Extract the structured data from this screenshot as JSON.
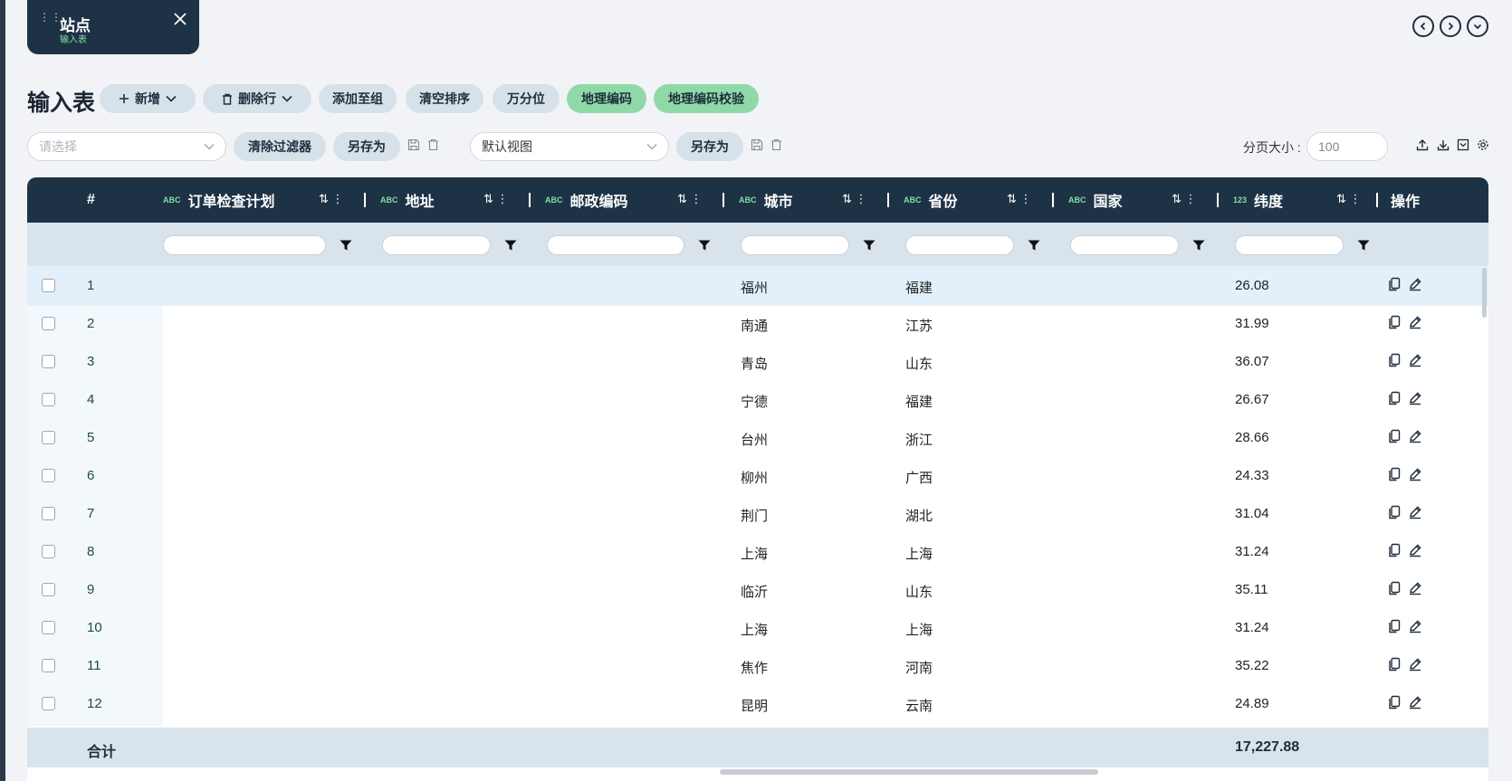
{
  "tab": {
    "title": "站点",
    "subtitle": "输入表"
  },
  "page": {
    "title": "输入表"
  },
  "toolbar": {
    "add_label": "新增",
    "delete_label": "删除行",
    "add_group_label": "添加至组",
    "clear_sort_label": "清空排序",
    "permille_label": "万分位",
    "geocode_label": "地理编码",
    "geocode_check_label": "地理编码校验"
  },
  "filterbar": {
    "select_placeholder": "请选择",
    "clear_filter_label": "清除过滤器",
    "save_as_label": "另存为",
    "view_value": "默认视图",
    "save_as_label_2": "另存为",
    "page_size_label": "分页大小 :",
    "page_size_value": "100"
  },
  "columns": {
    "index": "#",
    "c1": {
      "type": "ABC",
      "label": "订单检查计划"
    },
    "c2": {
      "type": "ABC",
      "label": "地址"
    },
    "c3": {
      "type": "ABC",
      "label": "邮政编码"
    },
    "c4": {
      "type": "ABC",
      "label": "城市"
    },
    "c5": {
      "type": "ABC",
      "label": "省份"
    },
    "c6": {
      "type": "ABC",
      "label": "国家"
    },
    "c7": {
      "type": "123",
      "label": "纬度"
    },
    "actions": "操作"
  },
  "rows": [
    {
      "n": "1",
      "city": "福州",
      "province": "福建",
      "lat": "26.08"
    },
    {
      "n": "2",
      "city": "南通",
      "province": "江苏",
      "lat": "31.99"
    },
    {
      "n": "3",
      "city": "青岛",
      "province": "山东",
      "lat": "36.07"
    },
    {
      "n": "4",
      "city": "宁德",
      "province": "福建",
      "lat": "26.67"
    },
    {
      "n": "5",
      "city": "台州",
      "province": "浙江",
      "lat": "28.66"
    },
    {
      "n": "6",
      "city": "柳州",
      "province": "广西",
      "lat": "24.33"
    },
    {
      "n": "7",
      "city": "荆门",
      "province": "湖北",
      "lat": "31.04"
    },
    {
      "n": "8",
      "city": "上海",
      "province": "上海",
      "lat": "31.24"
    },
    {
      "n": "9",
      "city": "临沂",
      "province": "山东",
      "lat": "35.11"
    },
    {
      "n": "10",
      "city": "上海",
      "province": "上海",
      "lat": "31.24"
    },
    {
      "n": "11",
      "city": "焦作",
      "province": "河南",
      "lat": "35.22"
    },
    {
      "n": "12",
      "city": "昆明",
      "province": "云南",
      "lat": "24.89"
    }
  ],
  "totals": {
    "label": "合计",
    "lat_sum": "17,227.88"
  },
  "colors": {
    "header": "#1e3246",
    "accent_green": "#8fd9a8",
    "filter_row": "#d8e3ec"
  }
}
